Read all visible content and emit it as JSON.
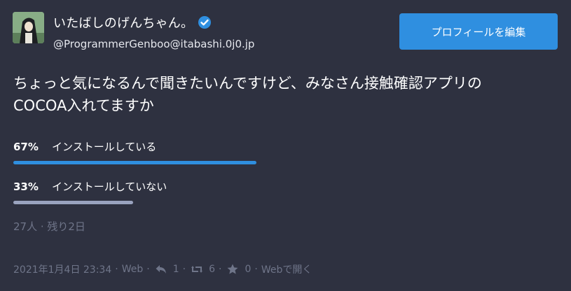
{
  "user": {
    "display_name": "いたばしのげんちゃん。",
    "handle": "@ProgrammerGenboo@itabashi.0j0.jp",
    "verified": true
  },
  "edit_button_label": "プロフィールを編集",
  "tweet": {
    "text_line1": "ちょっと気になるんで聞きたいんですけど、みなさん接触確認アプリの",
    "text_line2": "COCOA入れてますか"
  },
  "poll": {
    "options": [
      {
        "percent_label": "67%",
        "label": "インストールしている",
        "fraction": 0.67,
        "color": "#2f8fe0"
      },
      {
        "percent_label": "33%",
        "label": "インストールしていない",
        "fraction": 0.33,
        "color": "#9aa3bf"
      }
    ],
    "summary": "27人 · 残り2日"
  },
  "footer": {
    "timestamp": "2021年1月4日 23:34",
    "dot1": "·",
    "via": "Web",
    "dot2": "·",
    "reply_icon": "reply-icon",
    "reply_count": "1",
    "dot3": "·",
    "boost_icon": "boost-icon",
    "boost_count": "6",
    "dot4": "·",
    "star_icon": "star-icon",
    "star_count": "0",
    "dot5": "·",
    "open_web": "Webで開く"
  },
  "colors": {
    "background": "#2e3140",
    "accent": "#2f8fe0",
    "muted": "#6f7589"
  }
}
